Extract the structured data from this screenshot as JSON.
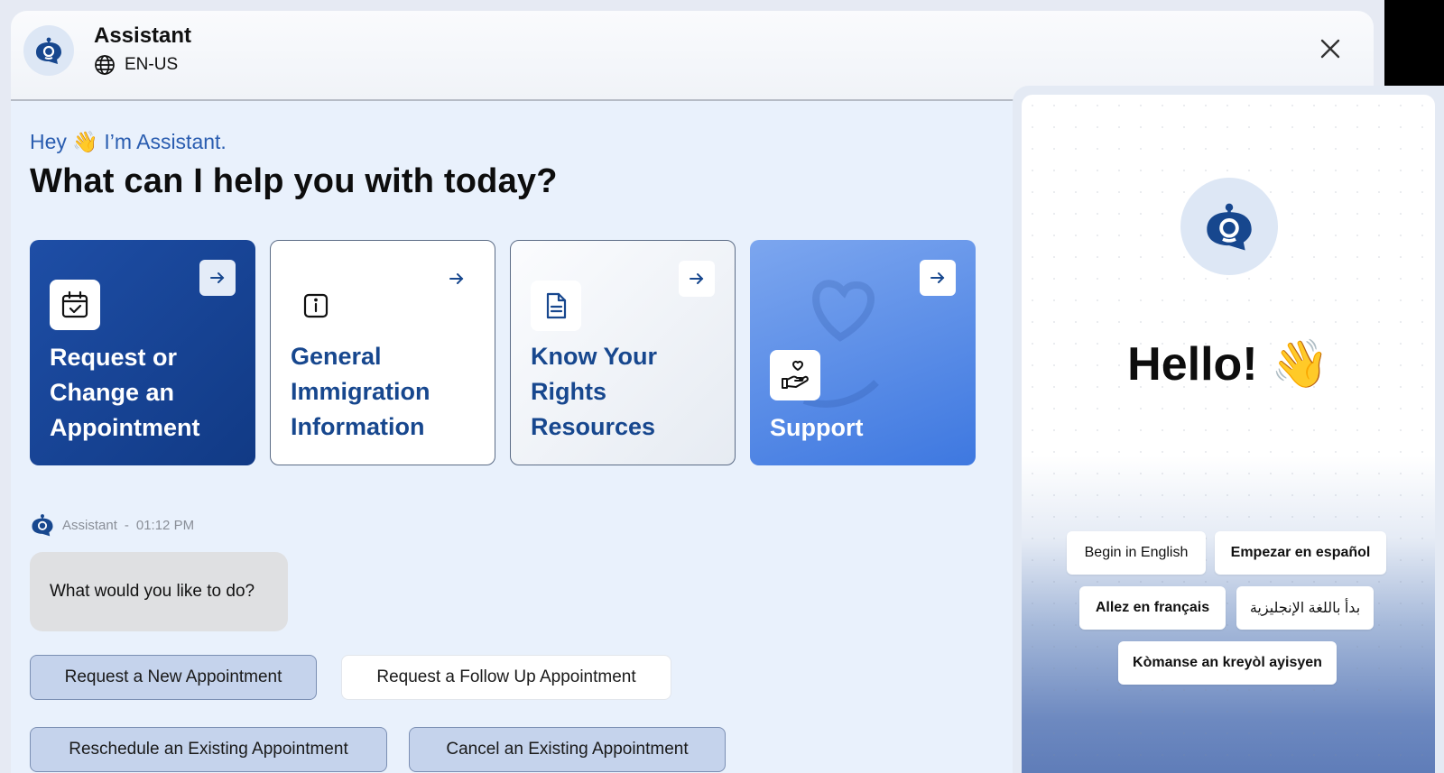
{
  "header": {
    "title": "Assistant",
    "language": "EN-US"
  },
  "greeting": "Hey 👋 I’m  Assistant.",
  "headline": "What can I help you with today?",
  "cards": [
    {
      "label": "Request or Change an Appointment",
      "icon": "calendar-check-icon"
    },
    {
      "label": "General Immigration Information",
      "icon": "info-icon"
    },
    {
      "label": "Know Your Rights Resources",
      "icon": "document-icon"
    },
    {
      "label": "Support",
      "icon": "hand-heart-icon"
    }
  ],
  "message": {
    "sender": "Assistant",
    "time": "01:12 PM",
    "text": "What would you like to do?"
  },
  "options": [
    "Request a New Appointment",
    "Request a Follow Up Appointment",
    "Reschedule an Existing Appointment",
    "Cancel an Existing Appointment"
  ],
  "widget": {
    "hello": "Hello! 👋",
    "languages": [
      "Begin in English",
      "Empezar en español",
      "Allez en français",
      "بدأ باللغة الإنجليزية",
      "Kòmanse an kreyòl ayisyen"
    ]
  },
  "colors": {
    "primary_blue": "#1e4ea6",
    "accent_blue": "#3e78e0",
    "greeting_blue": "#2a5db0",
    "card_text_blue": "#17478e"
  }
}
